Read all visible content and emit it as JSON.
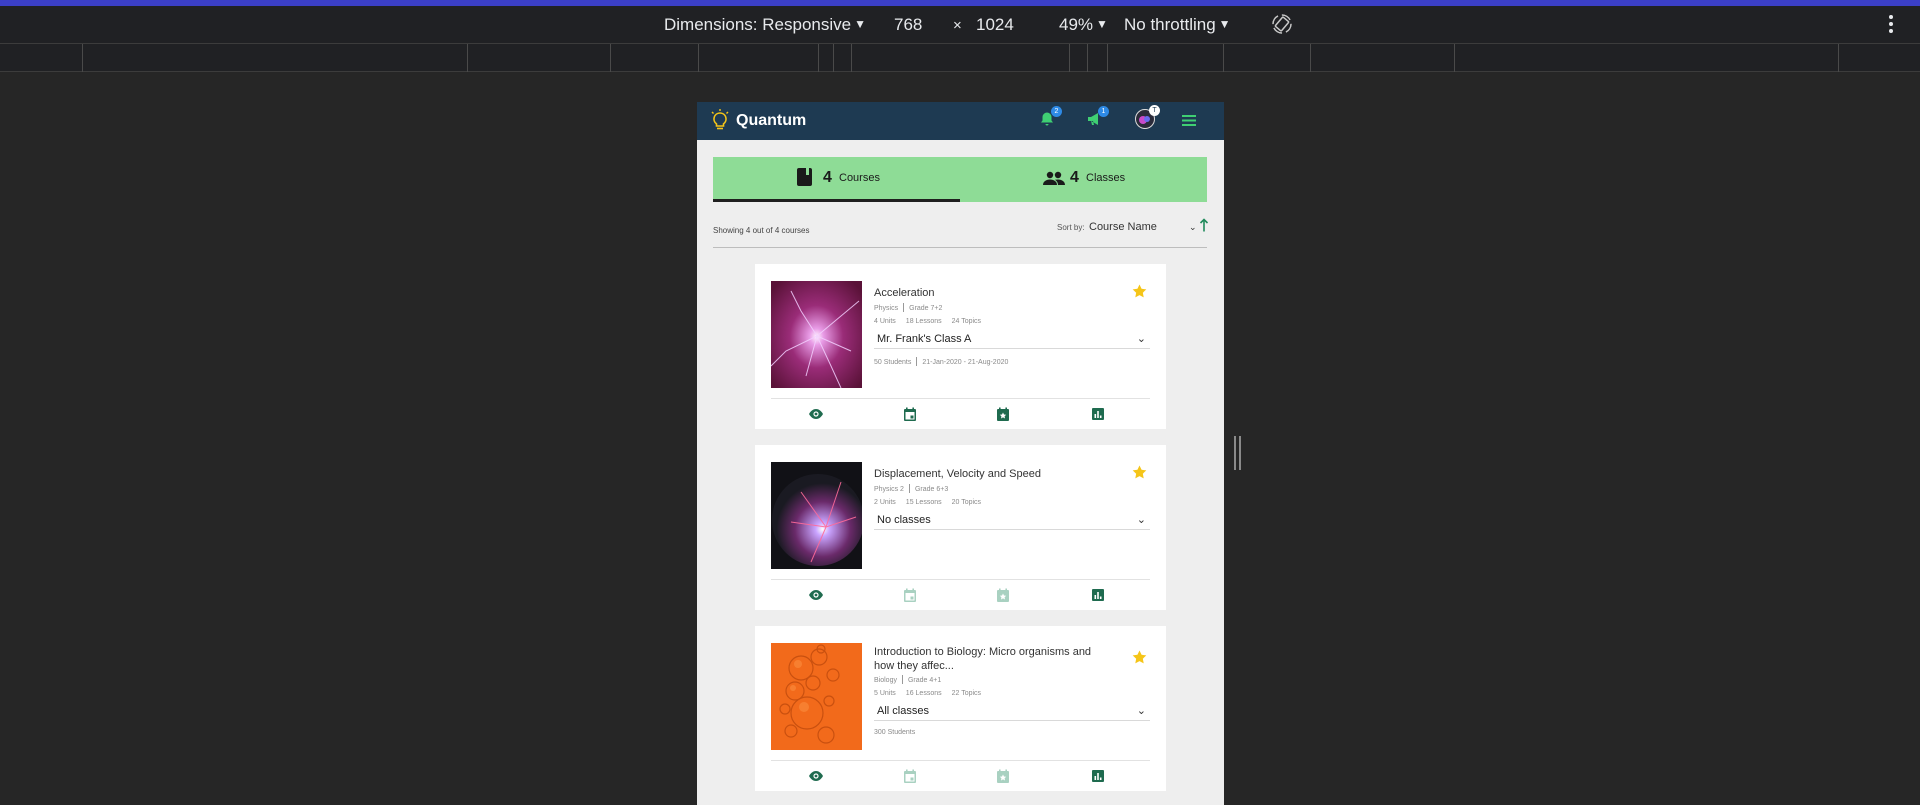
{
  "devtools": {
    "dimensions_label": "Dimensions: Responsive",
    "width": "768",
    "times": "×",
    "height": "1024",
    "zoom": "49%",
    "throttling": "No throttling"
  },
  "app": {
    "brand": "Quantum",
    "notifications_count": "2",
    "announcements_count": "1",
    "avatar_badge": "T"
  },
  "tabs": [
    {
      "count": "4",
      "label": "Courses",
      "active": true
    },
    {
      "count": "4",
      "label": "Classes",
      "active": false
    }
  ],
  "list": {
    "showing_text": "Showing 4 out of 4 courses",
    "sort_label": "Sort by:",
    "sort_value": "Course Name"
  },
  "courses": [
    {
      "title": "Acceleration",
      "subject": "Physics",
      "grade": "Grade 7+2",
      "units": "4 Units",
      "lessons": "18 Lessons",
      "topics": "24 Topics",
      "class_select": "Mr. Frank's Class A",
      "students": "50 Students",
      "dates": "21-Jan-2020 - 21-Aug-2020",
      "starred": true
    },
    {
      "title": "Displacement, Velocity and Speed",
      "subject": "Physics 2",
      "grade": "Grade 6+3",
      "units": "2 Units",
      "lessons": "15 Lessons",
      "topics": "20 Topics",
      "class_select": "No classes",
      "starred": true
    },
    {
      "title": "Introduction to Biology: Micro organisms and how they affec...",
      "subject": "Biology",
      "grade": "Grade 4+1",
      "units": "5 Units",
      "lessons": "16 Lessons",
      "topics": "22 Topics",
      "class_select": "All classes",
      "students": "300 Students",
      "starred": true
    }
  ],
  "colors": {
    "header": "#1e3a52",
    "tab_bg": "#8edc96",
    "action_green": "#1f6b4f",
    "star": "#f5c518"
  }
}
